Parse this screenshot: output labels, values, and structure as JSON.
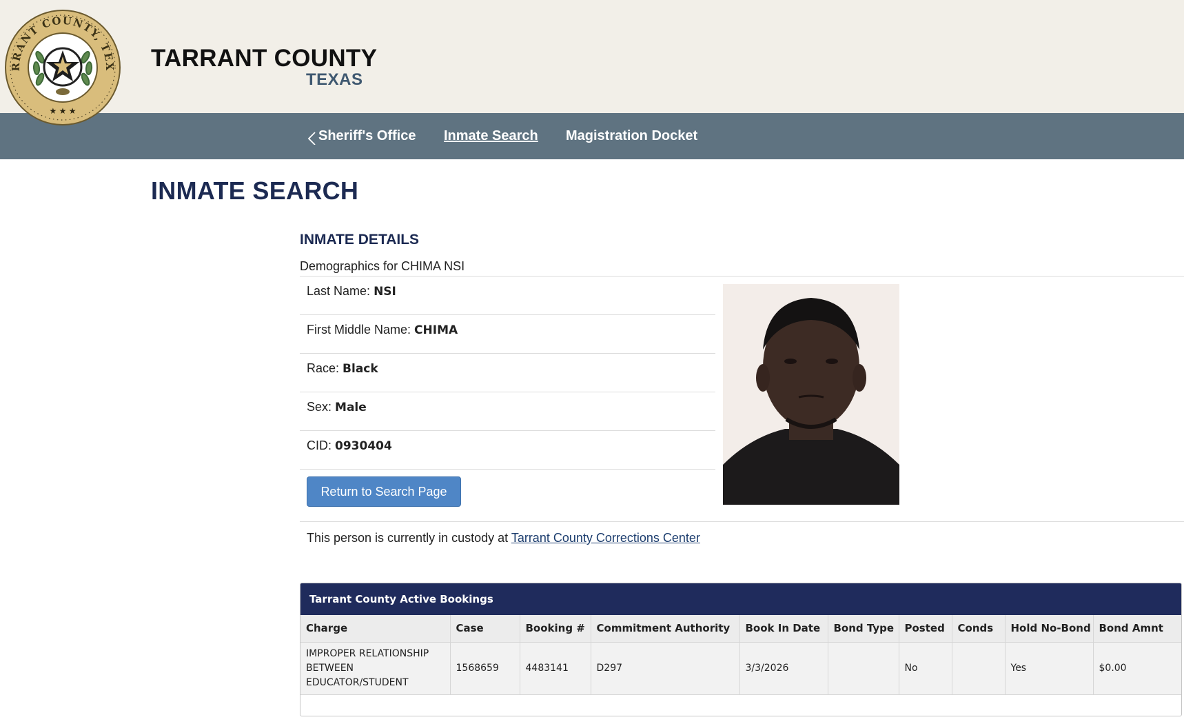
{
  "header": {
    "seal_text": "TARRANT COUNTY, TEXAS",
    "title": "TARRANT COUNTY",
    "subtitle": "TEXAS"
  },
  "nav": {
    "items": [
      {
        "label": "Sheriff's Office",
        "icon": "chevron-left-icon"
      },
      {
        "label": "Inmate Search",
        "active": true
      },
      {
        "label": "Magistration Docket"
      }
    ]
  },
  "page": {
    "title": "INMATE SEARCH"
  },
  "details": {
    "heading": "INMATE DETAILS",
    "demographics": "Demographics for CHIMA NSI",
    "fields": [
      {
        "label": "Last Name:",
        "value": "NSI"
      },
      {
        "label": "First Middle Name:",
        "value": "CHIMA"
      },
      {
        "label": "Race:",
        "value": "Black"
      },
      {
        "label": "Sex:",
        "value": "Male"
      },
      {
        "label": "CID:",
        "value": "0930404"
      }
    ],
    "return_button": "Return to Search Page",
    "custody_text": "This person is currently in custody at",
    "custody_link": "Tarrant County Corrections Center"
  },
  "bookings": {
    "title": "Tarrant County Active Bookings",
    "columns": [
      "Charge",
      "Case",
      "Booking #",
      "Commitment Authority",
      "Book In Date",
      "Bond Type",
      "Posted",
      "Conds",
      "Hold No-Bond",
      "Bond Amnt"
    ],
    "rows": [
      [
        "IMPROPER RELATIONSHIP BETWEEN EDUCATOR/STUDENT",
        "1568659",
        "4483141",
        "D297",
        "3/3/2026",
        "",
        "No",
        "",
        "Yes",
        "$0.00"
      ]
    ]
  },
  "colors": {
    "header_bg": "#f2efe8",
    "nav_bg": "#5f7381",
    "title_navy": "#1c2a52",
    "table_head": "#1f2b5c",
    "button_blue": "#4f86c6",
    "seal_gold": "#d9bd7c"
  }
}
